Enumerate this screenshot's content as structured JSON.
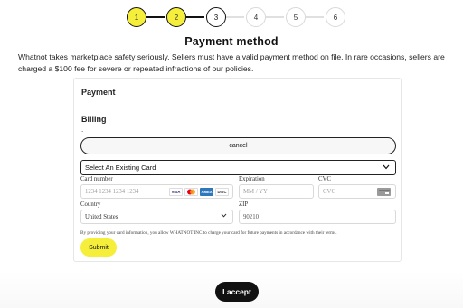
{
  "stepper": {
    "steps": [
      {
        "label": "1",
        "state": "done"
      },
      {
        "label": "2",
        "state": "done"
      },
      {
        "label": "3",
        "state": "current"
      },
      {
        "label": "4",
        "state": "todo"
      },
      {
        "label": "5",
        "state": "todo"
      },
      {
        "label": "6",
        "state": "todo"
      }
    ],
    "done_color": "#f5ee3b"
  },
  "page": {
    "title": "Payment method",
    "notice": "Whatnot takes marketplace safety seriously. Sellers must have a valid payment method on file. In rare occasions, sellers are charged a $100 fee for severe or repeated infractions of our policies."
  },
  "payment": {
    "heading": "Payment",
    "billing_heading": "Billing",
    "billing_dot": ".",
    "cancel_label": "cancel",
    "select_value": "Select An Existing Card",
    "card_number_label": "Card number",
    "card_number_placeholder": "1234 1234 1234 1234",
    "card_brands": [
      "VISA",
      "MC",
      "AMEX",
      "DISC"
    ],
    "expiration_label": "Expiration",
    "expiration_placeholder": "MM / YY",
    "cvc_label": "CVC",
    "cvc_placeholder": "CVC",
    "country_label": "Country",
    "country_value": "United States",
    "zip_label": "ZIP",
    "zip_value": "90210",
    "legal": "By providing your card information, you allow WHATNOT INC to charge your card for future payments in accordance with their terms.",
    "submit_label": "Submit"
  },
  "footer": {
    "accept_label": "I accept"
  },
  "colors": {
    "accent_yellow": "#f5ee3b",
    "dark": "#111111"
  }
}
